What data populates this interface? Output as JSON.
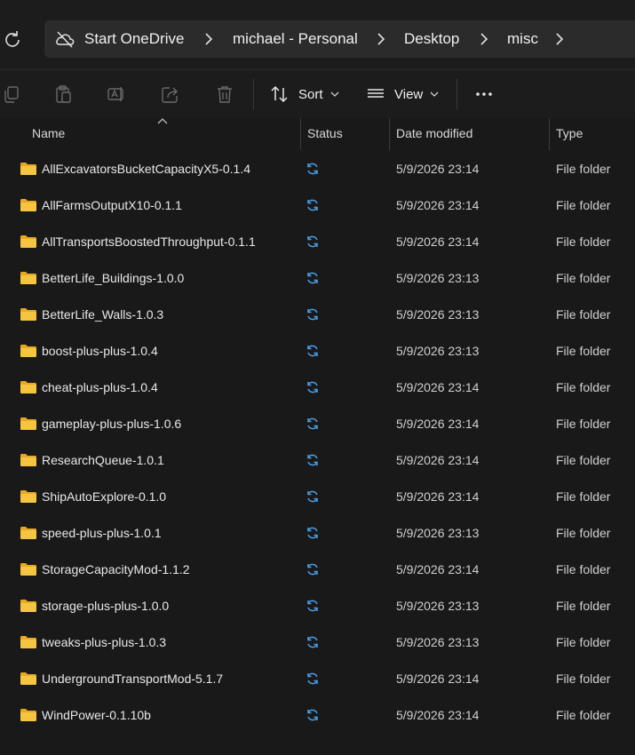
{
  "breadcrumb": {
    "items": [
      "Start OneDrive",
      "michael - Personal",
      "Desktop",
      "misc"
    ]
  },
  "toolbar": {
    "sort_label": "Sort",
    "view_label": "View",
    "icons": [
      "copy-icon",
      "paste-icon",
      "rename-icon",
      "share-icon",
      "delete-icon",
      "sort-icon",
      "view-icon",
      "more-icon"
    ]
  },
  "columns": {
    "name": "Name",
    "status": "Status",
    "date_modified": "Date modified",
    "type": "Type"
  },
  "colors": {
    "background": "#191919",
    "folder_yellow": "#f3c13a",
    "sync_blue": "#4a9fe8"
  },
  "files": [
    {
      "name": "AllExcavatorsBucketCapacityX5-0.1.4",
      "date": "5/9/2026 23:14",
      "type": "File folder"
    },
    {
      "name": "AllFarmsOutputX10-0.1.1",
      "date": "5/9/2026 23:14",
      "type": "File folder"
    },
    {
      "name": "AllTransportsBoostedThroughput-0.1.1",
      "date": "5/9/2026 23:14",
      "type": "File folder"
    },
    {
      "name": "BetterLife_Buildings-1.0.0",
      "date": "5/9/2026 23:13",
      "type": "File folder"
    },
    {
      "name": "BetterLife_Walls-1.0.3",
      "date": "5/9/2026 23:13",
      "type": "File folder"
    },
    {
      "name": "boost-plus-plus-1.0.4",
      "date": "5/9/2026 23:13",
      "type": "File folder"
    },
    {
      "name": "cheat-plus-plus-1.0.4",
      "date": "5/9/2026 23:14",
      "type": "File folder"
    },
    {
      "name": "gameplay-plus-plus-1.0.6",
      "date": "5/9/2026 23:14",
      "type": "File folder"
    },
    {
      "name": "ResearchQueue-1.0.1",
      "date": "5/9/2026 23:14",
      "type": "File folder"
    },
    {
      "name": "ShipAutoExplore-0.1.0",
      "date": "5/9/2026 23:14",
      "type": "File folder"
    },
    {
      "name": "speed-plus-plus-1.0.1",
      "date": "5/9/2026 23:13",
      "type": "File folder"
    },
    {
      "name": "StorageCapacityMod-1.1.2",
      "date": "5/9/2026 23:14",
      "type": "File folder"
    },
    {
      "name": "storage-plus-plus-1.0.0",
      "date": "5/9/2026 23:13",
      "type": "File folder"
    },
    {
      "name": "tweaks-plus-plus-1.0.3",
      "date": "5/9/2026 23:13",
      "type": "File folder"
    },
    {
      "name": "UndergroundTransportMod-5.1.7",
      "date": "5/9/2026 23:14",
      "type": "File folder"
    },
    {
      "name": "WindPower-0.1.10b",
      "date": "5/9/2026 23:14",
      "type": "File folder"
    }
  ]
}
